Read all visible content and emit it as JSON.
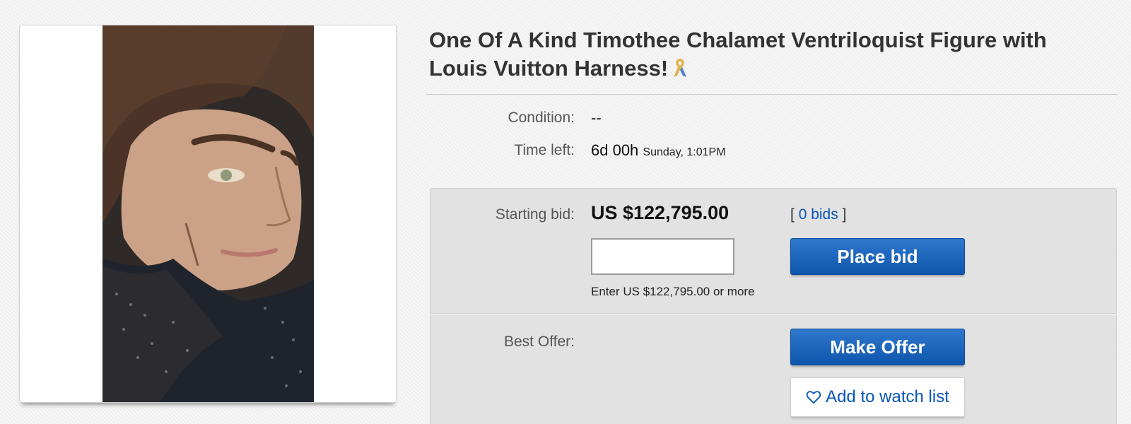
{
  "listing": {
    "title": "One Of A Kind Timothee Chalamet Ventriloquist Figure with Louis Vuitton Harness!",
    "ribbon_icon": "awareness-ribbon-icon",
    "condition_label": "Condition:",
    "condition_value": "--",
    "time_left_label": "Time left:",
    "time_left_value": "6d 00h",
    "time_left_end": "Sunday, 1:01PM"
  },
  "bidding": {
    "starting_bid_label": "Starting bid:",
    "price": "US $122,795.00",
    "bids_open": "[",
    "bids_count": "0 bids",
    "bids_close": "]",
    "bid_input_value": "",
    "hint": "Enter US $122,795.00 or more",
    "place_bid_label": "Place bid",
    "best_offer_label": "Best Offer:",
    "make_offer_label": "Make Offer",
    "watch_icon": "heart-icon",
    "watch_label": "Add to watch list"
  },
  "colors": {
    "link": "#0654ba",
    "button_blue": "#0e55ad",
    "panel_gray": "#e2e2e2"
  }
}
